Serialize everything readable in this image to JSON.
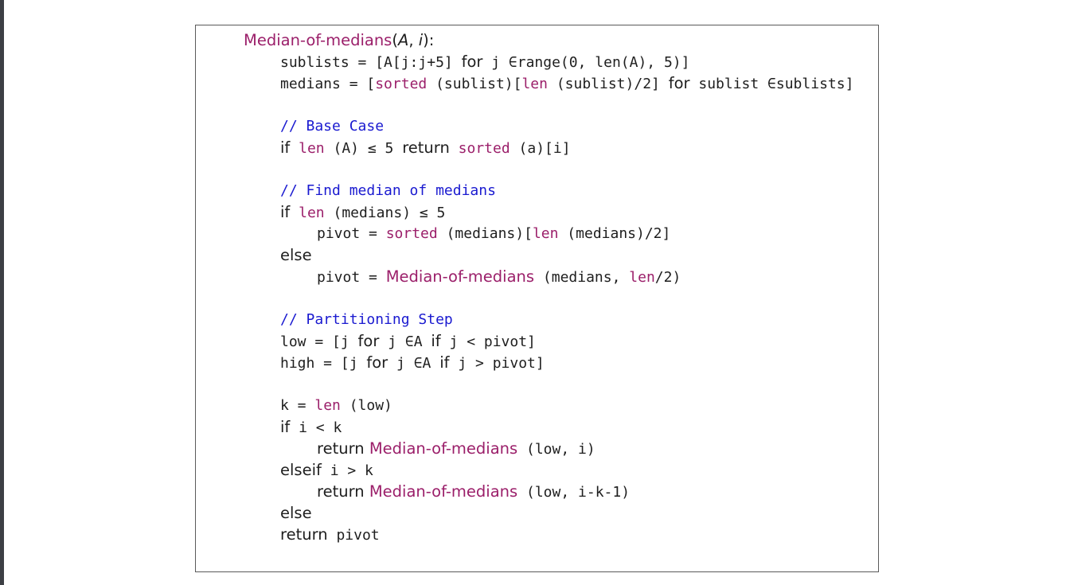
{
  "algorithm": {
    "header": {
      "name": "Median-of-medians",
      "params_open": "(",
      "param_a": "A",
      "param_sep": ", ",
      "param_i": "i",
      "params_close": "):"
    },
    "lines": {
      "sublists": {
        "code_a": "sublists = [A[j:j+5] ",
        "kw_for": "for",
        "code_b": " j ∈range(0, len(A), 5)]"
      },
      "medians": {
        "code_a": "medians = [",
        "fn_sorted": "sorted",
        "code_b": " (sublist)[",
        "fn_len": "len",
        "code_c": " (sublist)/2] ",
        "kw_for": "for",
        "code_d": " sublist ∈sublists]"
      },
      "comment_base": "// Base Case",
      "base_if": {
        "kw_if": "if",
        "fn_len": " len",
        "code_a": " (A) ≤ 5 ",
        "kw_return": "return",
        "fn_sorted": " sorted",
        "code_b": " (a)[i]"
      },
      "comment_find": "// Find median of medians",
      "find_if": {
        "kw_if": "if",
        "fn_len": " len",
        "code_a": " (medians) ≤ 5"
      },
      "pivot_sorted": {
        "code_a": "pivot = ",
        "fn_sorted": "sorted",
        "code_b": " (medians)[",
        "fn_len": "len",
        "code_c": " (medians)/2]"
      },
      "kw_else_1": "else",
      "pivot_recursive": {
        "code_a": "pivot = ",
        "fn_mom": "Median-of-medians",
        "code_b": " (medians, ",
        "fn_len": "len",
        "code_c": "/2)"
      },
      "comment_partition": "// Partitioning Step",
      "low": {
        "code_a": "low = [j ",
        "kw_for": "for",
        "code_b": " j ∈A ",
        "kw_if": "if",
        "code_c": " j < pivot]"
      },
      "high": {
        "code_a": "high = [j ",
        "kw_for": "for",
        "code_b": " j ∈A ",
        "kw_if": "if",
        "code_c": " j > pivot]"
      },
      "k_assign": {
        "code_a": "k = ",
        "fn_len": "len",
        "code_b": " (low)"
      },
      "if_i_lt_k": {
        "kw_if": "if",
        "code_a": " i < k"
      },
      "return_low": {
        "kw_return": "return",
        "fn_mom": " Median-of-medians",
        "code_a": " (low, i)"
      },
      "elseif_i_gt_k": {
        "kw_elseif": "elseif",
        "code_a": " i > k"
      },
      "return_low_k": {
        "kw_return": "return",
        "fn_mom": " Median-of-medians",
        "code_a": " (low, i-k-1)"
      },
      "kw_else_2": "else",
      "return_pivot": {
        "kw_return": "return",
        "code_a": " pivot"
      }
    }
  },
  "colors": {
    "function": "#9b1f6a",
    "comment": "#1a1ad0",
    "text": "#1e1e1e",
    "frame": "#5a5a5a",
    "rail": "#3c3f44"
  }
}
